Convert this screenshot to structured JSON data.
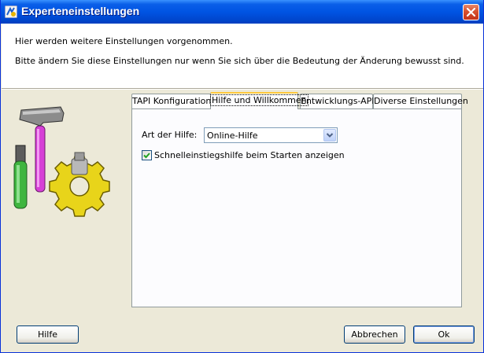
{
  "window": {
    "title": "Experteneinstellungen",
    "icon": "settings-app-icon",
    "close_icon": "close-icon"
  },
  "header": {
    "line1": "Hier werden weitere Einstellungen vorgenommen.",
    "line2": "Bitte ändern Sie diese Einstellungen nur wenn Sie sich über die Bedeutung der Änderung bewusst sind."
  },
  "illustration": {
    "icon": "tools-gear-icon"
  },
  "tabs": [
    {
      "label": "TAPI Konfiguration",
      "active": false
    },
    {
      "label": "Hilfe und Willkommen",
      "active": true
    },
    {
      "label": "Entwicklungs-API",
      "active": false
    },
    {
      "label": "Diverse Einstellungen",
      "active": false
    }
  ],
  "help_tab": {
    "type_label": "Art der Hilfe:",
    "type_value": "Online-Hilfe",
    "quickstart_label": "Schnelleinstiegshilfe beim Starten anzeigen",
    "quickstart_checked": true
  },
  "buttons": {
    "help": "Hilfe",
    "cancel": "Abbrechen",
    "ok": "Ok"
  },
  "colors": {
    "titlebar": "#0054E3",
    "dialog_bg": "#ECE9D8",
    "active_tab_accent": "#FFC83C",
    "check_mark": "#21A121"
  }
}
